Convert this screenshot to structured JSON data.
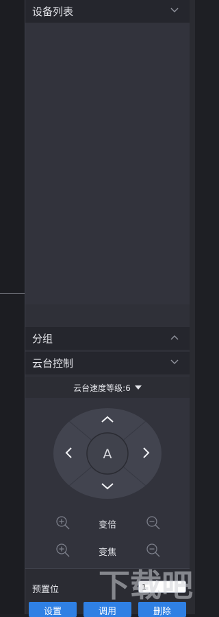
{
  "device_list": {
    "title": "设备列表"
  },
  "group": {
    "title": "分组"
  },
  "ptz": {
    "title": "云台控制",
    "speed_label": "云台速度等级:6",
    "center_label": "A",
    "zoom_label": "变倍",
    "focus_label": "变焦"
  },
  "preset": {
    "label": "预置位",
    "value": "1",
    "buttons": [
      "设置",
      "调用",
      "删除"
    ]
  },
  "colors": {
    "panel_bg": "#2f3038",
    "header_bg": "#25262d",
    "accent_blue": "#2f80e4"
  },
  "icons": {
    "collapse": "chevron-down-icon",
    "expand": "chevron-up-icon",
    "zoom_in": "zoom-in-icon",
    "zoom_out": "zoom-out-icon"
  },
  "watermark": {
    "text": "下载吧"
  }
}
